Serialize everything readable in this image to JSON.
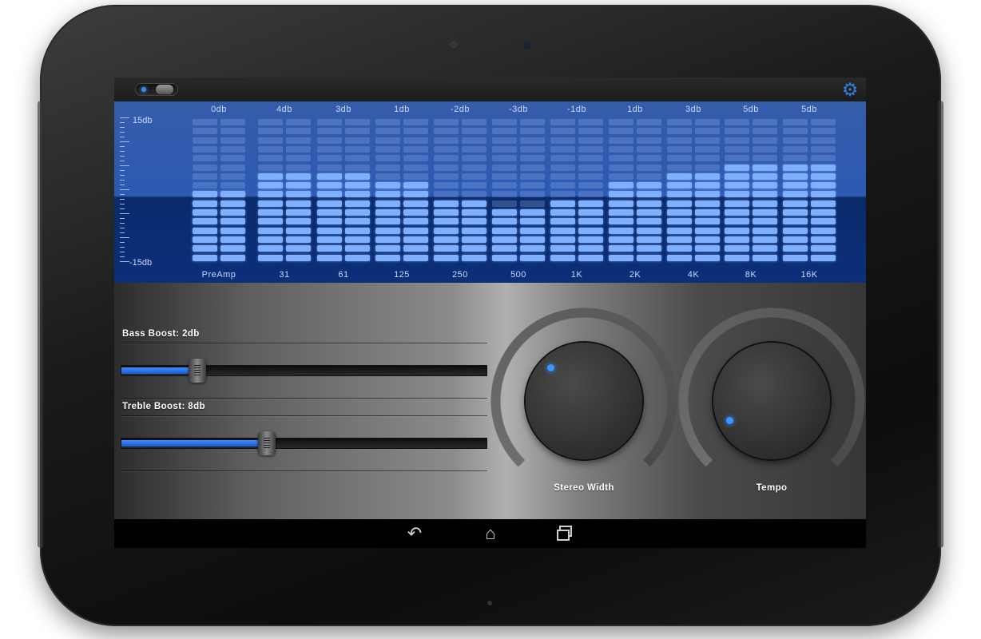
{
  "colors": {
    "accent": "#2f7fe0",
    "led": "#3d96ff",
    "eq_on": "#7fb0ff"
  },
  "topbar": {
    "power_icon": "toggle-switch",
    "settings_icon": "gear-icon"
  },
  "equalizer": {
    "scale_top": "15db",
    "scale_bottom": "-15db",
    "bands": [
      {
        "freq": "PreAmp",
        "gain_label": "0db",
        "gain": 0
      },
      {
        "freq": "31",
        "gain_label": "4db",
        "gain": 4
      },
      {
        "freq": "61",
        "gain_label": "3db",
        "gain": 3
      },
      {
        "freq": "125",
        "gain_label": "1db",
        "gain": 1
      },
      {
        "freq": "250",
        "gain_label": "-2db",
        "gain": -2
      },
      {
        "freq": "500",
        "gain_label": "-3db",
        "gain": -3
      },
      {
        "freq": "1K",
        "gain_label": "-1db",
        "gain": -1
      },
      {
        "freq": "2K",
        "gain_label": "1db",
        "gain": 1
      },
      {
        "freq": "4K",
        "gain_label": "3db",
        "gain": 3
      },
      {
        "freq": "8K",
        "gain_label": "5db",
        "gain": 5
      },
      {
        "freq": "16K",
        "gain_label": "5db",
        "gain": 5
      }
    ]
  },
  "bass": {
    "label": "Bass Boost: 2db",
    "fraction": 0.21
  },
  "treble": {
    "label": "Treble Boost: 8db",
    "fraction": 0.4
  },
  "knobs": [
    {
      "label": "Stereo Width",
      "angle_deg": -45
    },
    {
      "label": "Tempo",
      "angle_deg": -115
    }
  ],
  "navbar": {
    "back_icon": "back-icon",
    "home_icon": "home-icon",
    "recents_icon": "recents-icon"
  }
}
